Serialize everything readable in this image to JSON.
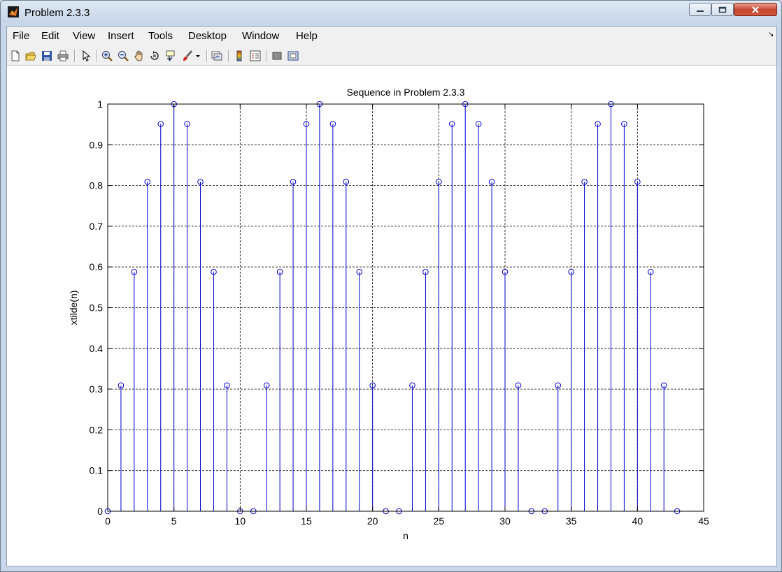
{
  "window": {
    "title": "Problem 2.3.3"
  },
  "menu": {
    "items": [
      "File",
      "Edit",
      "View",
      "Insert",
      "Tools",
      "Desktop",
      "Window",
      "Help"
    ]
  },
  "toolbar": {
    "buttons": [
      "new-figure-icon",
      "open-file-icon",
      "save-icon",
      "print-icon",
      "edit-plot-arrow-icon",
      "zoom-in-icon",
      "zoom-out-icon",
      "pan-hand-icon",
      "rotate-3d-icon",
      "data-cursor-icon",
      "brush-icon",
      "brush-dropdown-icon",
      "link-plot-icon",
      "insert-colorbar-icon",
      "insert-legend-icon",
      "hide-plot-tools-icon",
      "show-plot-tools-icon"
    ]
  },
  "colors": {
    "stem": "#0000cc",
    "grid": "#000000"
  },
  "chart_data": {
    "type": "stem",
    "title": "Sequence in Problem 2.3.3",
    "xlabel": "n",
    "ylabel": "xtilde(n)",
    "xlim": [
      0,
      45
    ],
    "ylim": [
      0,
      1
    ],
    "xticks": [
      0,
      5,
      10,
      15,
      20,
      25,
      30,
      35,
      40,
      45
    ],
    "yticks": [
      0,
      0.1,
      0.2,
      0.3,
      0.4,
      0.5,
      0.6,
      0.7,
      0.8,
      0.9,
      1
    ],
    "ytick_labels": [
      "0",
      "0.1",
      "0.2",
      "0.3",
      "0.4",
      "0.5",
      "0.6",
      "0.7",
      "0.8",
      "0.9",
      "1"
    ],
    "grid": true,
    "grid_style": "dashed",
    "marker": "open-circle",
    "x": [
      0,
      1,
      2,
      3,
      4,
      5,
      6,
      7,
      8,
      9,
      10,
      11,
      12,
      13,
      14,
      15,
      16,
      17,
      18,
      19,
      20,
      21,
      22,
      23,
      24,
      25,
      26,
      27,
      28,
      29,
      30,
      31,
      32,
      33,
      34,
      35,
      36,
      37,
      38,
      39,
      40,
      41,
      42,
      43
    ],
    "y": [
      0,
      0.309,
      0.5878,
      0.809,
      0.9511,
      1,
      0.9511,
      0.809,
      0.5878,
      0.309,
      0,
      0,
      0.309,
      0.5878,
      0.809,
      0.9511,
      1,
      0.9511,
      0.809,
      0.5878,
      0.309,
      0,
      0,
      0.309,
      0.5878,
      0.809,
      0.9511,
      1,
      0.9511,
      0.809,
      0.5878,
      0.309,
      0,
      0,
      0.309,
      0.5878,
      0.809,
      0.9511,
      1,
      0.9511,
      0.809,
      0.5878,
      0.309,
      0
    ]
  }
}
